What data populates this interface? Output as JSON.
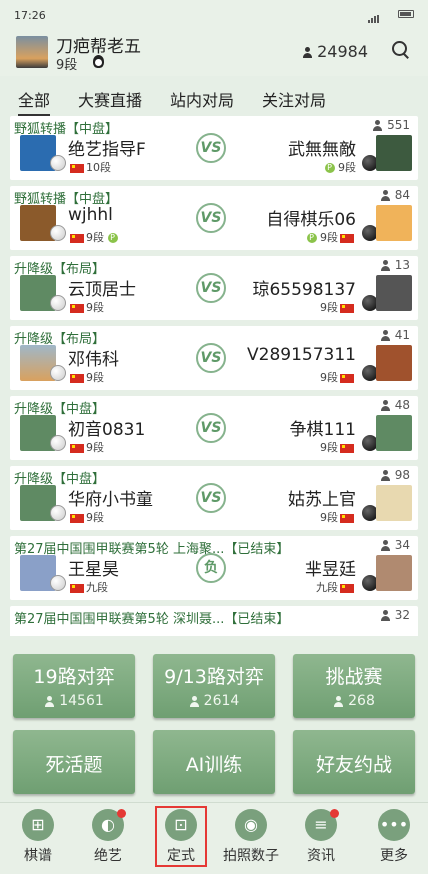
{
  "status": {
    "time": "17:26"
  },
  "user": {
    "name": "刀疤帮老五",
    "rank": "9段",
    "online_count": "24984"
  },
  "tabs": [
    "全部",
    "大赛直播",
    "站内对局",
    "关注对局"
  ],
  "games": [
    {
      "title": "野狐转播【中盘】",
      "viewers": "551",
      "left_name": "绝艺指导F",
      "left_rank": "10段",
      "right_name": "武無無敵",
      "right_rank": "9段"
    },
    {
      "title": "野狐转播【中盘】",
      "viewers": "84",
      "left_name": "wjhhl",
      "left_rank": "9段",
      "right_name": "自得棋乐06",
      "right_rank": "9段"
    },
    {
      "title": "升降级【布局】",
      "viewers": "13",
      "left_name": "云顶居士",
      "left_rank": "9段",
      "right_name": "琼65598137",
      "right_rank": "9段"
    },
    {
      "title": "升降级【布局】",
      "viewers": "41",
      "left_name": "邓伟科",
      "left_rank": "9段",
      "right_name": "V289157311",
      "right_rank": "9段"
    },
    {
      "title": "升降级【中盘】",
      "viewers": "48",
      "left_name": "初音0831",
      "left_rank": "9段",
      "right_name": "争棋111",
      "right_rank": "9段"
    },
    {
      "title": "升降级【中盘】",
      "viewers": "98",
      "left_name": "华府小书童",
      "left_rank": "9段",
      "right_name": "姑苏上官",
      "right_rank": "9段"
    },
    {
      "title": "第27届中国围甲联赛第5轮 上海聚...【已结束】",
      "viewers": "34",
      "left_name": "王星昊",
      "left_rank": "九段",
      "right_name": "芈昱廷",
      "right_rank": "九段",
      "result": "负"
    },
    {
      "title": "第27届中国围甲联赛第5轮 深圳聂...【已结束】",
      "viewers": "32",
      "left_name": "",
      "left_rank": "",
      "right_name": "",
      "right_rank": ""
    }
  ],
  "buttons": [
    {
      "label": "19路对弈",
      "count": "14561"
    },
    {
      "label": "9/13路对弈",
      "count": "2614"
    },
    {
      "label": "挑战赛",
      "count": "268"
    },
    {
      "label": "死活题"
    },
    {
      "label": "AI训练"
    },
    {
      "label": "好友约战"
    }
  ],
  "nav": [
    "棋谱",
    "绝艺",
    "定式",
    "拍照数子",
    "资讯",
    "更多"
  ],
  "vs_label": "VS"
}
